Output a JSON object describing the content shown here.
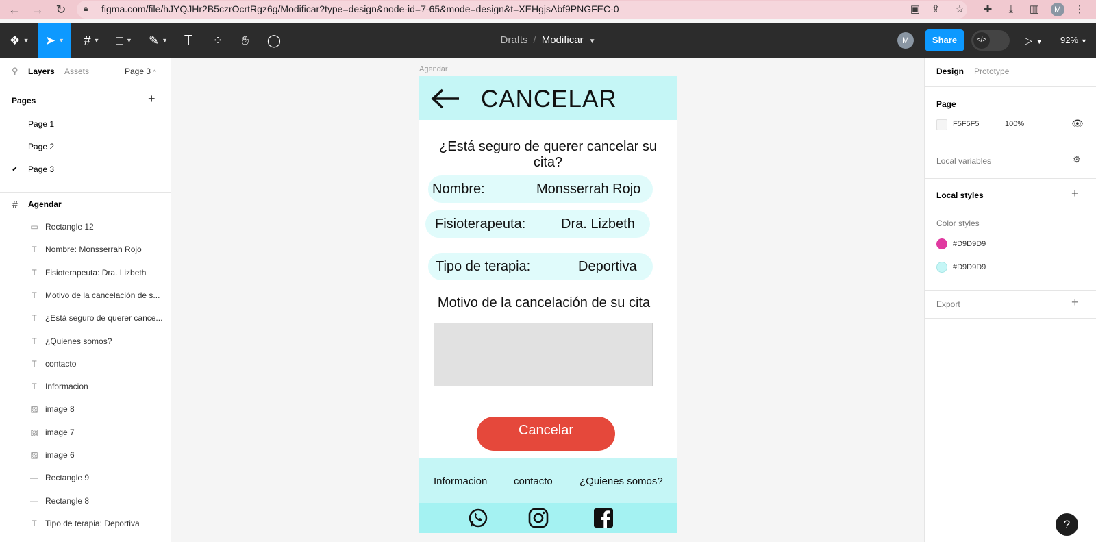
{
  "browser": {
    "url": "figma.com/file/hJYQJHr2B5czrOcrtRgz6g/Modificar?type=design&node-id=7-65&mode=design&t=XEHgjsAbf9PNGFEC-0",
    "profile_initial": "M"
  },
  "toolbar": {
    "breadcrumb_drafts": "Drafts",
    "breadcrumb_sep": "/",
    "file_name": "Modificar",
    "avatar_initial": "M",
    "share_label": "Share",
    "zoom": "92%"
  },
  "left_panel": {
    "tab_layers": "Layers",
    "tab_assets": "Assets",
    "current_page": "Page 3",
    "pages_heading": "Pages",
    "pages": [
      "Page 1",
      "Page 2",
      "Page 3"
    ],
    "frame_name": "Agendar",
    "layers": [
      {
        "name": "Rectangle 12",
        "icon": "rectangle-icon"
      },
      {
        "name": "Nombre: Monsserrah Rojo",
        "icon": "text-icon"
      },
      {
        "name": "Fisioterapeuta: Dra. Lizbeth",
        "icon": "text-icon"
      },
      {
        "name": "Motivo de la cancelación de s...",
        "icon": "text-icon"
      },
      {
        "name": "¿Está seguro de querer cance...",
        "icon": "text-icon"
      },
      {
        "name": "¿Quienes somos?",
        "icon": "text-icon"
      },
      {
        "name": "contacto",
        "icon": "text-icon"
      },
      {
        "name": "Informacion",
        "icon": "text-icon"
      },
      {
        "name": "image 8",
        "icon": "image-icon"
      },
      {
        "name": "image 7",
        "icon": "image-icon"
      },
      {
        "name": "image 6",
        "icon": "image-icon"
      },
      {
        "name": "Rectangle 9",
        "icon": "line-icon"
      },
      {
        "name": "Rectangle 8",
        "icon": "line-icon"
      },
      {
        "name": "Tipo de terapia: Deportiva",
        "icon": "text-icon"
      }
    ]
  },
  "canvas": {
    "frame_label": "Agendar",
    "title": "CANCELAR",
    "question": "¿Está seguro de querer cancelar su cita?",
    "nombre_label": "Nombre:",
    "nombre_value": "Monsserrah Rojo",
    "fisio_label": "Fisioterapeuta:",
    "fisio_value": "Dra. Lizbeth",
    "terapia_label": "Tipo de terapia:",
    "terapia_value": "Deportiva",
    "motivo_label": "Motivo de la cancelación de su cita",
    "cancel_button": "Cancelar",
    "footer_links": [
      "Informacion",
      "contacto",
      "¿Quienes somos?"
    ],
    "colors": {
      "header": "#c5f6f6",
      "social_bar": "#a4f2f2",
      "cancel": "#e5483b",
      "textarea": "#e1e1e1"
    }
  },
  "right_panel": {
    "tab_design": "Design",
    "tab_prototype": "Prototype",
    "page_heading": "Page",
    "page_color": "F5F5F5",
    "page_opacity": "100%",
    "local_variables": "Local variables",
    "local_styles": "Local styles",
    "color_styles": "Color styles",
    "styles": [
      {
        "name": "#D9D9D9",
        "color": "#e03aa0"
      },
      {
        "name": "#D9D9D9",
        "color": "#c5f6f6"
      }
    ],
    "export": "Export"
  },
  "help_label": "?"
}
